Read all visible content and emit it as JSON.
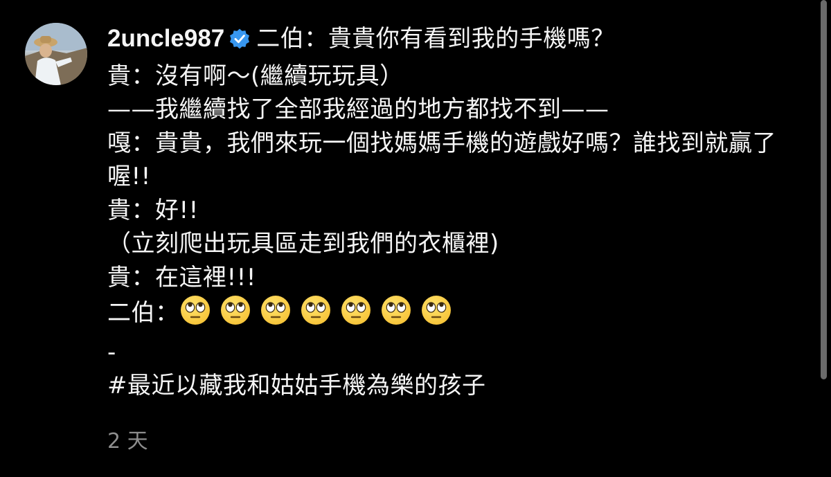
{
  "post": {
    "username": "2uncle987",
    "verified": true,
    "lines": {
      "l1": "二伯：貴貴你有看到我的手機嗎？",
      "l2": "貴：沒有啊～(繼續玩玩具）",
      "l3": "——我繼續找了全部我經過的地方都找不到——",
      "l4": "嘎：貴貴，我們來玩一個找媽媽手機的遊戲好嗎？誰找到就贏了喔!!",
      "l5": "貴：好!!",
      "l6": "（立刻爬出玩具區走到我們的衣櫃裡)",
      "l7": "貴：在這裡!!!",
      "l8": "二伯：",
      "l9": "-",
      "l10": "#最近以藏我和姑姑手機為樂的孩子"
    },
    "emoji_name": "face-with-rolling-eyes",
    "emoji_count": 7,
    "timestamp": "2 天"
  },
  "colors": {
    "background": "#000000",
    "text": "#f5f5f5",
    "meta": "#8e8e8e",
    "verified": "#3897f0",
    "emoji_face": "#f7c53a"
  }
}
